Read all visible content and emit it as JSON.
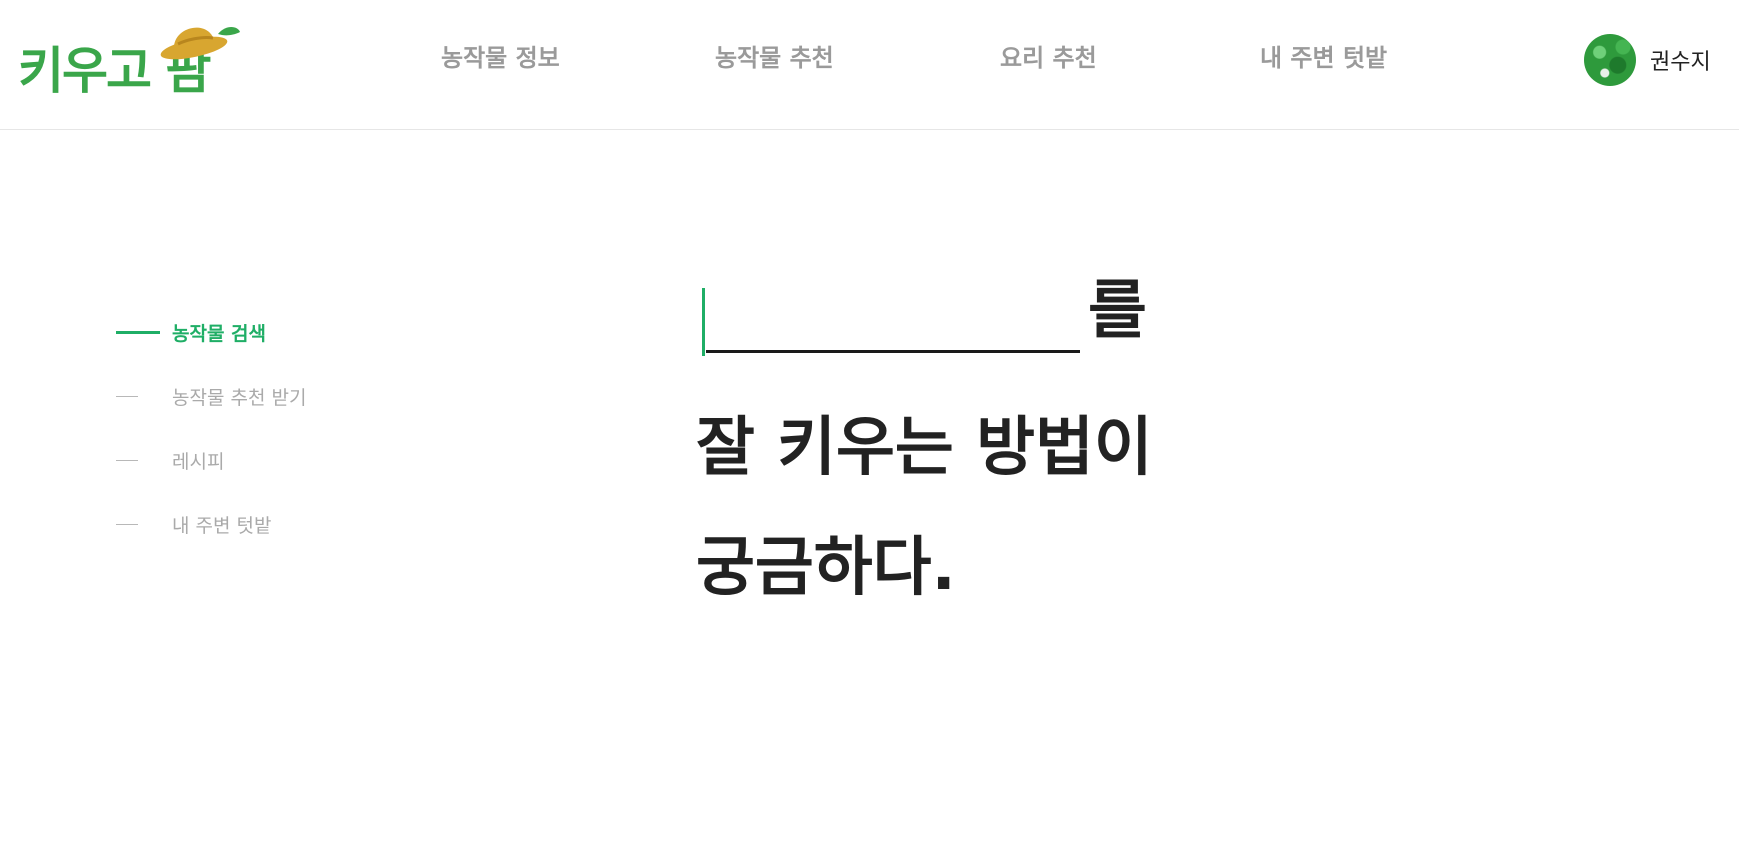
{
  "header": {
    "logo": {
      "text": "키우고 팜",
      "colors": {
        "text": "#3aa64a",
        "hat": "#d8a630",
        "leaf": "#3aa64a"
      }
    },
    "nav": [
      {
        "label": "농작물 정보"
      },
      {
        "label": "농작물 추천"
      },
      {
        "label": "요리 추천"
      },
      {
        "label": "내 주변 텃밭"
      }
    ],
    "user": {
      "name": "권수지",
      "avatar_icon": "avatar-photo"
    }
  },
  "side_nav": {
    "items": [
      {
        "label": "농작물 검색",
        "active": true
      },
      {
        "label": "농작물 추천 받기",
        "active": false
      },
      {
        "label": "레시피",
        "active": false
      },
      {
        "label": "내 주변 텃밭",
        "active": false
      }
    ]
  },
  "hero": {
    "search": {
      "value": "",
      "placeholder": ""
    },
    "particle": "를",
    "line1": "잘 키우는 방법이",
    "line2": "궁금하다."
  },
  "colors": {
    "accent": "#1fae66",
    "text": "#222222",
    "muted": "#9a9a9a",
    "border": "#e6e6e6"
  }
}
